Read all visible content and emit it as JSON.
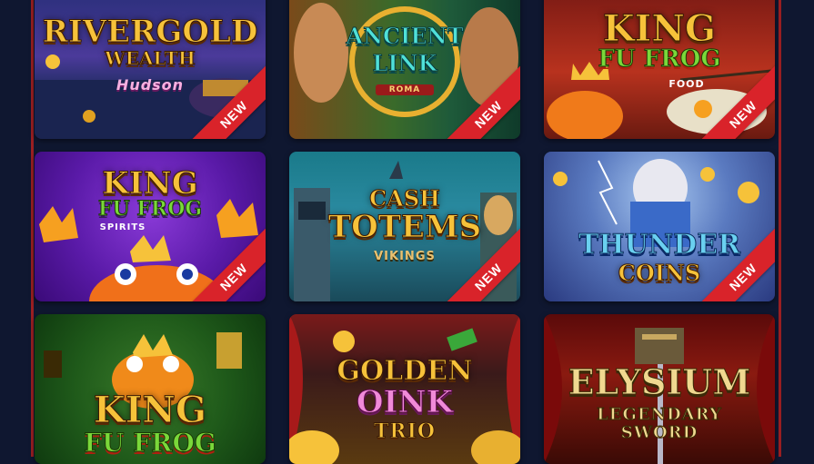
{
  "colors": {
    "page_bg": "#0f1730",
    "frame_red": "#9a1f22",
    "badge_red": "#d9232a",
    "gold": "#f6c23a"
  },
  "games": [
    {
      "title_line1": "RIVERGOLD",
      "title_line2": "WEALTH",
      "subtitle": "Hudson",
      "badge": "NEW"
    },
    {
      "title_line1": "ANCIENT",
      "title_line2": "LINK",
      "subtitle": "ROMA",
      "badge": "NEW"
    },
    {
      "title_line1": "KING",
      "title_line2": "FU FROG",
      "subtitle": "FOOD",
      "badge": "NEW"
    },
    {
      "title_line1": "KING",
      "title_line2": "FU FROG",
      "subtitle": "SPIRITS",
      "badge": "NEW"
    },
    {
      "title_line1": "CASH",
      "title_line2": "TOTEMS",
      "subtitle": "VIKINGS",
      "badge": "NEW"
    },
    {
      "title_line1": "THUNDER",
      "title_line2": "COINS",
      "subtitle": "",
      "badge": "NEW"
    },
    {
      "title_line1": "KING",
      "title_line2": "FU FROG",
      "subtitle": "",
      "badge": ""
    },
    {
      "title_line1": "GOLDEN",
      "title_line2": "OINK",
      "subtitle": "TRIO",
      "badge": ""
    },
    {
      "title_line1": "ELYSIUM",
      "title_line2": "LEGENDARY",
      "subtitle": "SWORD",
      "badge": ""
    }
  ]
}
